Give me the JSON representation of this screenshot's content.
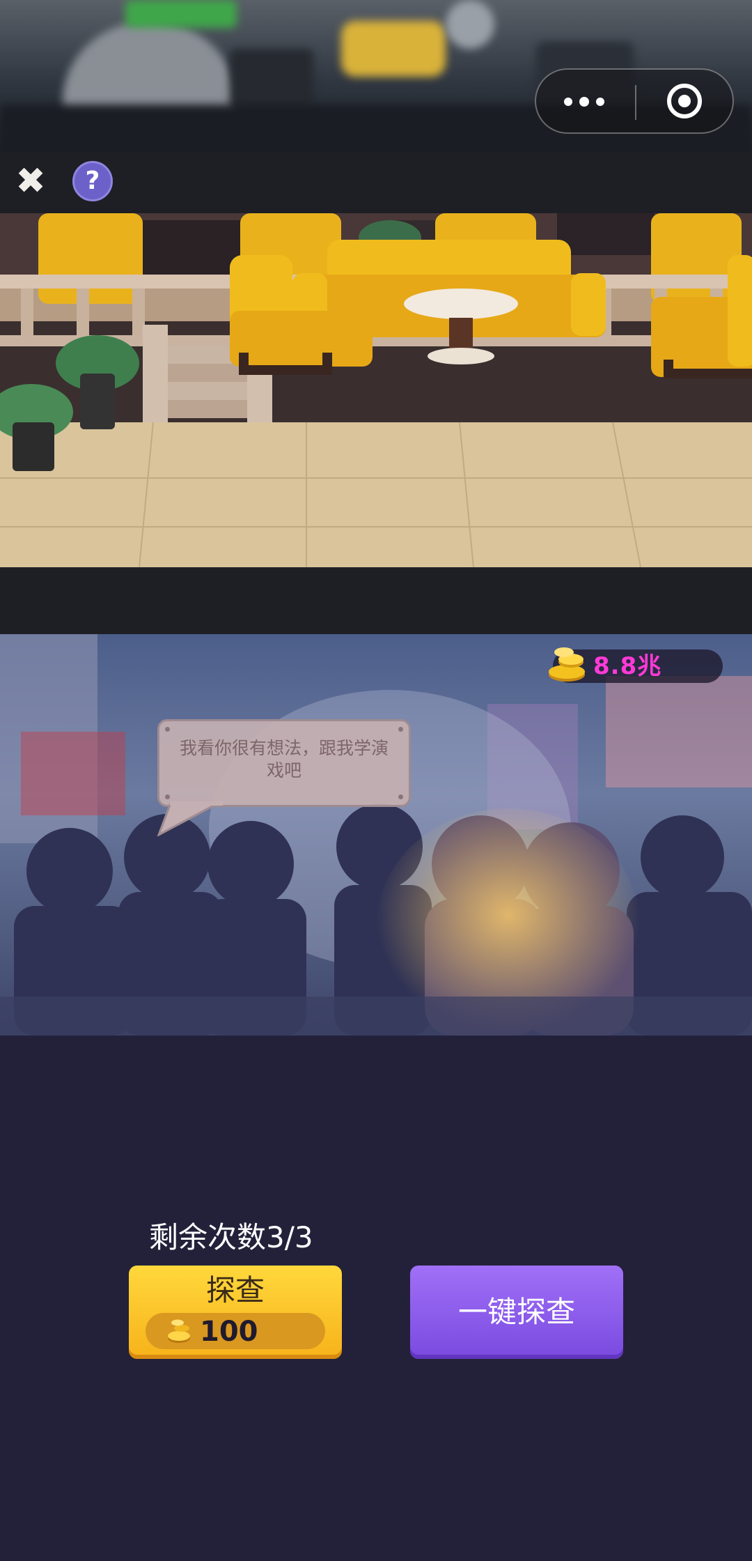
{
  "icons": {
    "close": "close-icon",
    "help": "help-icon",
    "more": "more-dots-icon",
    "miniprogram_close": "target-icon",
    "coin": "gold-coin-icon"
  },
  "toolbar": {
    "close_glyph": "✖",
    "help_glyph": "?"
  },
  "currency": {
    "amount": "8.8兆"
  },
  "speech_bubble": {
    "text": "我看你很有想法，跟我学演戏吧"
  },
  "investigate": {
    "remaining_label": "剩余次数3/3",
    "explore_label": "探查",
    "explore_cost": "100",
    "one_click_label": "一键探查"
  },
  "colors": {
    "page_bg": "#23213a",
    "coin_text": "#ff3ad6",
    "explore_btn": "#f7b21a",
    "one_click_btn": "#8a58ec"
  }
}
